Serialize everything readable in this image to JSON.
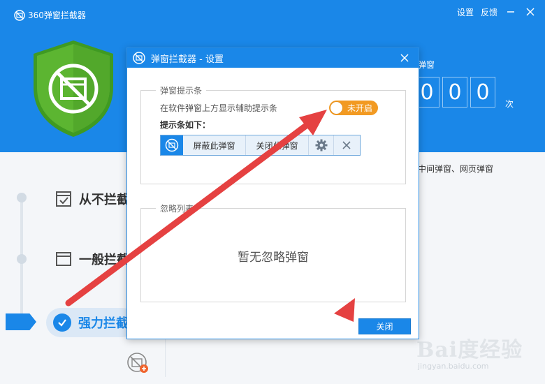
{
  "app": {
    "title": "360弹窗拦截器",
    "settings_link": "设置",
    "feedback_link": "反馈",
    "counter": {
      "label": "弹窗",
      "digits": [
        "0",
        "0",
        "0"
      ],
      "unit": "次"
    },
    "types_text": "中间弹窗、网页弹窗",
    "modes": [
      {
        "label": "从不拦截",
        "icon": "checkbox-window-icon",
        "active": false
      },
      {
        "label": "一般拦截",
        "icon": "window-icon",
        "active": false
      },
      {
        "label": "强力拦截",
        "icon": "check-icon",
        "active": true
      }
    ],
    "colors": {
      "brand_blue": "#1a87e8",
      "toggle_orange": "#f29a22",
      "arrow_red": "#e54141",
      "shield_green": "#5cb531"
    }
  },
  "dialog": {
    "title": "弹窗拦截器 - 设置",
    "section_notice": {
      "legend": "弹窗提示条",
      "description": "在软件弹窗上方显示辅助提示条",
      "toggle_label": "未开启",
      "toggle_on": false,
      "preview_label": "提示条如下：",
      "preview_bar": {
        "block_button": "屏蔽此弹窗",
        "close_button": "关闭此弹窗"
      }
    },
    "section_ignore": {
      "legend": "忽略列表",
      "empty_text": "暂无忽略弹窗"
    },
    "close_button": "关闭"
  },
  "watermark": {
    "brand": "Bai度经验",
    "url": "jingyan.baidu.com"
  }
}
